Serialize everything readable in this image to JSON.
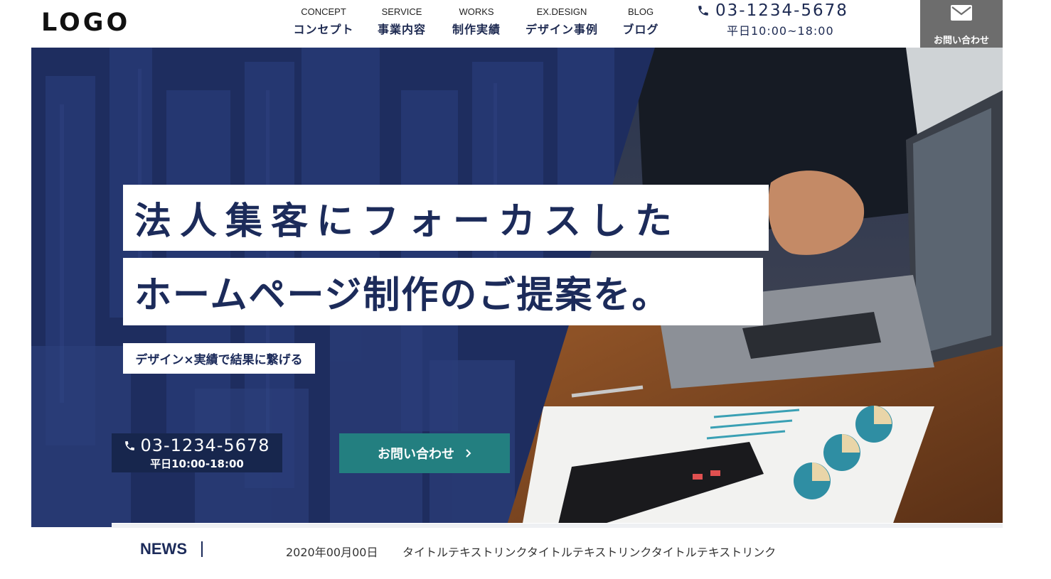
{
  "header": {
    "logo": "LOGO",
    "nav": [
      {
        "en": "CONCEPT",
        "jp": "コンセプト"
      },
      {
        "en": "SERVICE",
        "jp": "事業内容"
      },
      {
        "en": "WORKS",
        "jp": "制作実績"
      },
      {
        "en": "EX.DESIGN",
        "jp": "デザイン事例"
      },
      {
        "en": "BLOG",
        "jp": "ブログ"
      }
    ],
    "phone": "03-1234-5678",
    "hours": "平日10:00~18:00",
    "contact_label": "お問い合わせ"
  },
  "hero": {
    "catch_line1": "法人集客にフォーカスした",
    "catch_line2": "ホームページ制作のご提案を。",
    "subcopy": "デザイン×実績で結果に繋げる",
    "phone": "03-1234-5678",
    "hours": "平日10:00-18:00",
    "cta_label": "お問い合わせ"
  },
  "news": {
    "label": "NEWS",
    "date": "2020年00月00日",
    "title": "タイトルテキストリンクタイトルテキストリンクタイトルテキストリンク"
  },
  "colors": {
    "navy": "#1c2b5a",
    "teal": "#237f80",
    "contact_gray": "#6d6d6d"
  },
  "icons": [
    "phone-icon",
    "mail-icon",
    "chevron-right-icon"
  ]
}
